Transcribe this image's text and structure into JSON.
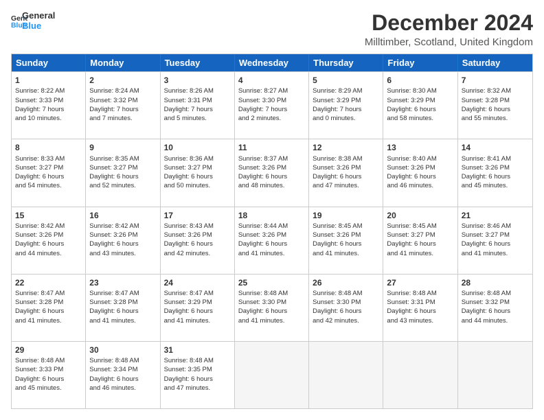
{
  "logo": {
    "line1": "General",
    "line2": "Blue"
  },
  "title": "December 2024",
  "location": "Milltimber, Scotland, United Kingdom",
  "header_days": [
    "Sunday",
    "Monday",
    "Tuesday",
    "Wednesday",
    "Thursday",
    "Friday",
    "Saturday"
  ],
  "weeks": [
    [
      {
        "day": "1",
        "lines": [
          "Sunrise: 8:22 AM",
          "Sunset: 3:33 PM",
          "Daylight: 7 hours",
          "and 10 minutes."
        ]
      },
      {
        "day": "2",
        "lines": [
          "Sunrise: 8:24 AM",
          "Sunset: 3:32 PM",
          "Daylight: 7 hours",
          "and 7 minutes."
        ]
      },
      {
        "day": "3",
        "lines": [
          "Sunrise: 8:26 AM",
          "Sunset: 3:31 PM",
          "Daylight: 7 hours",
          "and 5 minutes."
        ]
      },
      {
        "day": "4",
        "lines": [
          "Sunrise: 8:27 AM",
          "Sunset: 3:30 PM",
          "Daylight: 7 hours",
          "and 2 minutes."
        ]
      },
      {
        "day": "5",
        "lines": [
          "Sunrise: 8:29 AM",
          "Sunset: 3:29 PM",
          "Daylight: 7 hours",
          "and 0 minutes."
        ]
      },
      {
        "day": "6",
        "lines": [
          "Sunrise: 8:30 AM",
          "Sunset: 3:29 PM",
          "Daylight: 6 hours",
          "and 58 minutes."
        ]
      },
      {
        "day": "7",
        "lines": [
          "Sunrise: 8:32 AM",
          "Sunset: 3:28 PM",
          "Daylight: 6 hours",
          "and 55 minutes."
        ]
      }
    ],
    [
      {
        "day": "8",
        "lines": [
          "Sunrise: 8:33 AM",
          "Sunset: 3:27 PM",
          "Daylight: 6 hours",
          "and 54 minutes."
        ]
      },
      {
        "day": "9",
        "lines": [
          "Sunrise: 8:35 AM",
          "Sunset: 3:27 PM",
          "Daylight: 6 hours",
          "and 52 minutes."
        ]
      },
      {
        "day": "10",
        "lines": [
          "Sunrise: 8:36 AM",
          "Sunset: 3:27 PM",
          "Daylight: 6 hours",
          "and 50 minutes."
        ]
      },
      {
        "day": "11",
        "lines": [
          "Sunrise: 8:37 AM",
          "Sunset: 3:26 PM",
          "Daylight: 6 hours",
          "and 48 minutes."
        ]
      },
      {
        "day": "12",
        "lines": [
          "Sunrise: 8:38 AM",
          "Sunset: 3:26 PM",
          "Daylight: 6 hours",
          "and 47 minutes."
        ]
      },
      {
        "day": "13",
        "lines": [
          "Sunrise: 8:40 AM",
          "Sunset: 3:26 PM",
          "Daylight: 6 hours",
          "and 46 minutes."
        ]
      },
      {
        "day": "14",
        "lines": [
          "Sunrise: 8:41 AM",
          "Sunset: 3:26 PM",
          "Daylight: 6 hours",
          "and 45 minutes."
        ]
      }
    ],
    [
      {
        "day": "15",
        "lines": [
          "Sunrise: 8:42 AM",
          "Sunset: 3:26 PM",
          "Daylight: 6 hours",
          "and 44 minutes."
        ]
      },
      {
        "day": "16",
        "lines": [
          "Sunrise: 8:42 AM",
          "Sunset: 3:26 PM",
          "Daylight: 6 hours",
          "and 43 minutes."
        ]
      },
      {
        "day": "17",
        "lines": [
          "Sunrise: 8:43 AM",
          "Sunset: 3:26 PM",
          "Daylight: 6 hours",
          "and 42 minutes."
        ]
      },
      {
        "day": "18",
        "lines": [
          "Sunrise: 8:44 AM",
          "Sunset: 3:26 PM",
          "Daylight: 6 hours",
          "and 41 minutes."
        ]
      },
      {
        "day": "19",
        "lines": [
          "Sunrise: 8:45 AM",
          "Sunset: 3:26 PM",
          "Daylight: 6 hours",
          "and 41 minutes."
        ]
      },
      {
        "day": "20",
        "lines": [
          "Sunrise: 8:45 AM",
          "Sunset: 3:27 PM",
          "Daylight: 6 hours",
          "and 41 minutes."
        ]
      },
      {
        "day": "21",
        "lines": [
          "Sunrise: 8:46 AM",
          "Sunset: 3:27 PM",
          "Daylight: 6 hours",
          "and 41 minutes."
        ]
      }
    ],
    [
      {
        "day": "22",
        "lines": [
          "Sunrise: 8:47 AM",
          "Sunset: 3:28 PM",
          "Daylight: 6 hours",
          "and 41 minutes."
        ]
      },
      {
        "day": "23",
        "lines": [
          "Sunrise: 8:47 AM",
          "Sunset: 3:28 PM",
          "Daylight: 6 hours",
          "and 41 minutes."
        ]
      },
      {
        "day": "24",
        "lines": [
          "Sunrise: 8:47 AM",
          "Sunset: 3:29 PM",
          "Daylight: 6 hours",
          "and 41 minutes."
        ]
      },
      {
        "day": "25",
        "lines": [
          "Sunrise: 8:48 AM",
          "Sunset: 3:30 PM",
          "Daylight: 6 hours",
          "and 41 minutes."
        ]
      },
      {
        "day": "26",
        "lines": [
          "Sunrise: 8:48 AM",
          "Sunset: 3:30 PM",
          "Daylight: 6 hours",
          "and 42 minutes."
        ]
      },
      {
        "day": "27",
        "lines": [
          "Sunrise: 8:48 AM",
          "Sunset: 3:31 PM",
          "Daylight: 6 hours",
          "and 43 minutes."
        ]
      },
      {
        "day": "28",
        "lines": [
          "Sunrise: 8:48 AM",
          "Sunset: 3:32 PM",
          "Daylight: 6 hours",
          "and 44 minutes."
        ]
      }
    ],
    [
      {
        "day": "29",
        "lines": [
          "Sunrise: 8:48 AM",
          "Sunset: 3:33 PM",
          "Daylight: 6 hours",
          "and 45 minutes."
        ]
      },
      {
        "day": "30",
        "lines": [
          "Sunrise: 8:48 AM",
          "Sunset: 3:34 PM",
          "Daylight: 6 hours",
          "and 46 minutes."
        ]
      },
      {
        "day": "31",
        "lines": [
          "Sunrise: 8:48 AM",
          "Sunset: 3:35 PM",
          "Daylight: 6 hours",
          "and 47 minutes."
        ]
      },
      {
        "day": "",
        "lines": []
      },
      {
        "day": "",
        "lines": []
      },
      {
        "day": "",
        "lines": []
      },
      {
        "day": "",
        "lines": []
      }
    ]
  ]
}
